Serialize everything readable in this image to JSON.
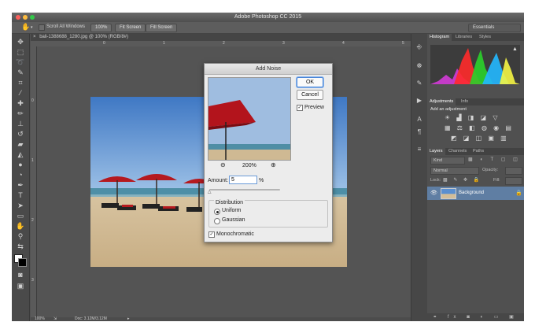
{
  "app": {
    "title": "Adobe Photoshop CC 2015",
    "workspace": "Essentials"
  },
  "options_bar": {
    "scroll_all_windows": "Scroll All Windows",
    "zoom_100": "100%",
    "fit_screen": "Fit Screen",
    "fill_screen": "Fill Screen"
  },
  "document": {
    "tab": "bali-1388688_1280.jpg @ 100% (RGB/8#)",
    "ruler_top": [
      "0",
      "1",
      "2",
      "3",
      "4",
      "5"
    ],
    "ruler_left": [
      "0",
      "1",
      "2",
      "3"
    ]
  },
  "status": {
    "zoom": "100%",
    "doc_size": "Doc: 3.12M/3.12M"
  },
  "panels": {
    "top_tabs": [
      "Histogram",
      "Libraries",
      "Styles"
    ],
    "adjustments_tabs": [
      "Adjustments",
      "Info"
    ],
    "adjustments_heading": "Add an adjustment",
    "layers_tabs": [
      "Layers",
      "Channels",
      "Paths"
    ],
    "layers_kind": "Kind",
    "blend_mode": "Normal",
    "opacity_label": "Opacity:",
    "lock_label": "Lock:",
    "fill_label": "Fill:",
    "layer_name": "Background"
  },
  "dialog": {
    "title": "Add Noise",
    "ok": "OK",
    "cancel": "Cancel",
    "preview_label": "Preview",
    "preview_checked": true,
    "zoom": "200%",
    "amount_label": "Amount:",
    "amount_value": "5",
    "amount_unit": "%",
    "amount_fraction": 0.01,
    "distribution_label": "Distribution",
    "uniform_label": "Uniform",
    "gaussian_label": "Gaussian",
    "distribution_selected": "Uniform",
    "monochromatic_label": "Monochromatic",
    "monochromatic_checked": true
  }
}
